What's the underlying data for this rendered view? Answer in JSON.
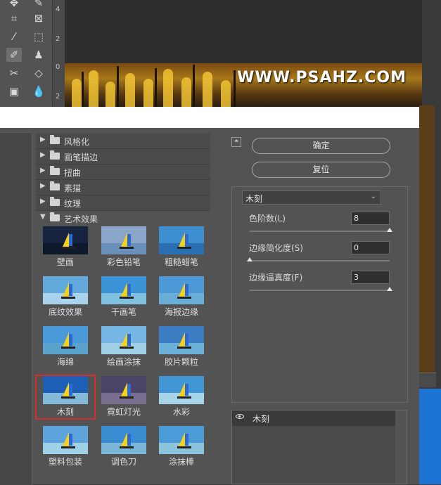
{
  "watermark": "WWW.PSAHZ.COM",
  "ruler_numbers": [
    "4",
    "2",
    "0",
    "2"
  ],
  "toolbar_icons": [
    "move-icon",
    "pen-icon",
    "crop-icon",
    "frame-icon",
    "eyedropper-icon",
    "marquee-icon",
    "brush-icon",
    "stamp-icon",
    "healing-icon",
    "eraser-icon",
    "gradient-icon",
    "blur-icon"
  ],
  "categories": [
    {
      "label": "风格化",
      "expanded": false
    },
    {
      "label": "画笔描边",
      "expanded": false
    },
    {
      "label": "扭曲",
      "expanded": false
    },
    {
      "label": "素描",
      "expanded": false
    },
    {
      "label": "纹理",
      "expanded": false
    },
    {
      "label": "艺术效果",
      "expanded": true
    }
  ],
  "thumbnails": [
    {
      "label": "壁画"
    },
    {
      "label": "彩色铅笔"
    },
    {
      "label": "粗糙蜡笔"
    },
    {
      "label": "底纹效果"
    },
    {
      "label": "干画笔"
    },
    {
      "label": "海报边缘"
    },
    {
      "label": "海绵"
    },
    {
      "label": "绘画涂抹"
    },
    {
      "label": "胶片颗粒"
    },
    {
      "label": "木刻",
      "selected": true
    },
    {
      "label": "霓虹灯光"
    },
    {
      "label": "水彩"
    },
    {
      "label": "塑料包装"
    },
    {
      "label": "调色刀"
    },
    {
      "label": "涂抹棒"
    }
  ],
  "buttons": {
    "ok": "确定",
    "reset": "复位"
  },
  "filter_select": {
    "value": "木刻"
  },
  "params": [
    {
      "label": "色阶数(L)",
      "value": "8",
      "level": 1.0
    },
    {
      "label": "边缘简化度(S)",
      "value": "0",
      "level": 0.0
    },
    {
      "label": "边缘逼真度(F)",
      "value": "3",
      "level": 1.0
    }
  ],
  "effect_layer": {
    "name": "木刻"
  },
  "colors": {
    "selection": "#d2302c",
    "panel": "#535353",
    "accent_blue": "#1e74d4"
  }
}
